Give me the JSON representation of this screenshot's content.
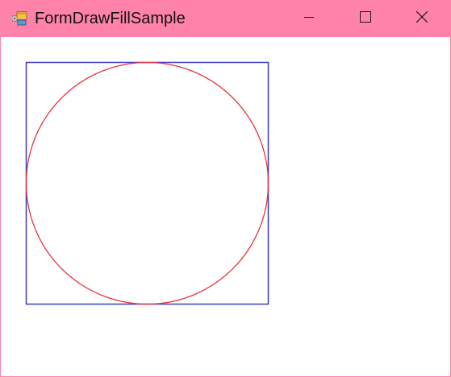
{
  "window": {
    "title": "FormDrawFillSample",
    "app_icon": "winforms-app-icon",
    "title_bar_color": "#ff82aa"
  },
  "title_buttons": {
    "minimize_icon": "minimize-icon",
    "maximize_icon": "maximize-icon",
    "close_icon": "close-icon"
  },
  "canvas": {
    "background": "#ffffff",
    "square_color": "#3b3bbf",
    "circle_color": "#e8323c"
  }
}
